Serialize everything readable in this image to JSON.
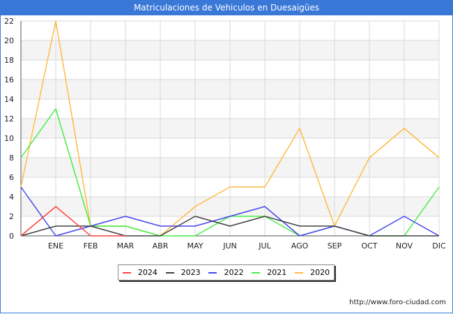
{
  "header": {
    "title": "Matriculaciones de Vehiculos en Duesaigües"
  },
  "source": "http://www.foro-ciudad.com",
  "chart_data": {
    "type": "line",
    "title": "Matriculaciones de Vehiculos en Duesaigües",
    "xlabel": "",
    "ylabel": "",
    "categories": [
      "",
      "ENE",
      "FEB",
      "MAR",
      "ABR",
      "MAY",
      "JUN",
      "JUL",
      "AGO",
      "SEP",
      "OCT",
      "NOV",
      "DIC"
    ],
    "ylim": [
      0,
      22
    ],
    "yticks": [
      0,
      2,
      4,
      6,
      8,
      10,
      12,
      14,
      16,
      18,
      20,
      22
    ],
    "grid": true,
    "legend_position": "bottom",
    "series": [
      {
        "name": "2024",
        "color": "#ff4040",
        "values": [
          0,
          3,
          0,
          0,
          null,
          null,
          null,
          null,
          null,
          null,
          null,
          null,
          null
        ]
      },
      {
        "name": "2023",
        "color": "#404040",
        "values": [
          0,
          1,
          1,
          0,
          0,
          2,
          1,
          2,
          1,
          1,
          0,
          0,
          0
        ]
      },
      {
        "name": "2022",
        "color": "#4444ee",
        "values": [
          5,
          0,
          1,
          2,
          1,
          1,
          2,
          3,
          0,
          1,
          0,
          2,
          0
        ]
      },
      {
        "name": "2021",
        "color": "#44ee44",
        "values": [
          8,
          13,
          1,
          1,
          0,
          0,
          2,
          2,
          0,
          1,
          0,
          0,
          5
        ]
      },
      {
        "name": "2020",
        "color": "#ffbb44",
        "values": [
          5,
          22,
          1,
          1,
          0,
          3,
          5,
          5,
          11,
          1,
          8,
          11,
          8
        ]
      }
    ]
  }
}
